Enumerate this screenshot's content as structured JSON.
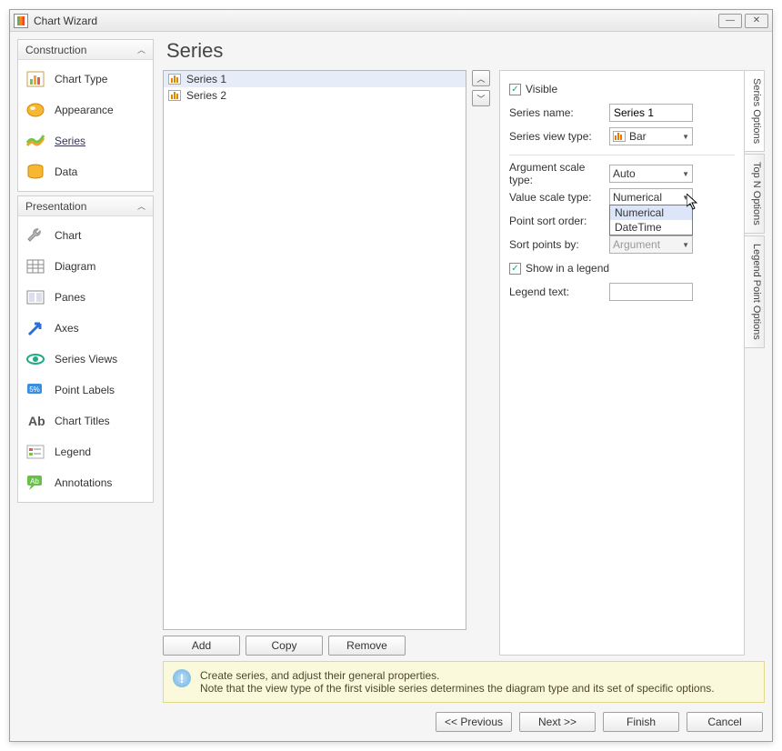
{
  "window": {
    "title": "Chart Wizard"
  },
  "page_heading": "Series",
  "sidebar": {
    "groups": [
      {
        "title": "Construction",
        "items": [
          {
            "label": "Chart Type",
            "icon": "chart-type-icon"
          },
          {
            "label": "Appearance",
            "icon": "appearance-icon"
          },
          {
            "label": "Series",
            "icon": "series-icon",
            "active": true
          },
          {
            "label": "Data",
            "icon": "data-icon"
          }
        ]
      },
      {
        "title": "Presentation",
        "items": [
          {
            "label": "Chart",
            "icon": "wrench-icon"
          },
          {
            "label": "Diagram",
            "icon": "grid-icon"
          },
          {
            "label": "Panes",
            "icon": "panes-icon"
          },
          {
            "label": "Axes",
            "icon": "arrow-icon"
          },
          {
            "label": "Series Views",
            "icon": "eye-icon"
          },
          {
            "label": "Point Labels",
            "icon": "label-icon"
          },
          {
            "label": "Chart Titles",
            "icon": "titles-icon"
          },
          {
            "label": "Legend",
            "icon": "legend-icon"
          },
          {
            "label": "Annotations",
            "icon": "annotation-icon"
          }
        ]
      }
    ]
  },
  "series_list": [
    "Series 1",
    "Series 2"
  ],
  "list_actions": {
    "add": "Add",
    "copy": "Copy",
    "remove": "Remove"
  },
  "properties": {
    "visible_label": "Visible",
    "visible": true,
    "series_name_label": "Series name:",
    "series_name": "Series 1",
    "series_view_type_label": "Series view type:",
    "series_view_type": "Bar",
    "argument_scale_type_label": "Argument scale type:",
    "argument_scale_type": "Auto",
    "value_scale_type_label": "Value scale type:",
    "value_scale_type": "Numerical",
    "value_scale_type_options": [
      "Numerical",
      "DateTime"
    ],
    "point_sort_order_label": "Point sort order:",
    "sort_points_by_label": "Sort points by:",
    "sort_points_by": "Argument",
    "show_in_legend_label": "Show in a legend",
    "show_in_legend": true,
    "legend_text_label": "Legend text:",
    "legend_text": ""
  },
  "vtabs": [
    "Series Options",
    "Top N Options",
    "Legend Point Options"
  ],
  "hint": {
    "line1": "Create series, and adjust their general properties.",
    "line2": "Note that the view type of the first visible series determines the diagram type and its set of specific options."
  },
  "footer": {
    "prev": "<< Previous",
    "next": "Next >>",
    "finish": "Finish",
    "cancel": "Cancel"
  }
}
